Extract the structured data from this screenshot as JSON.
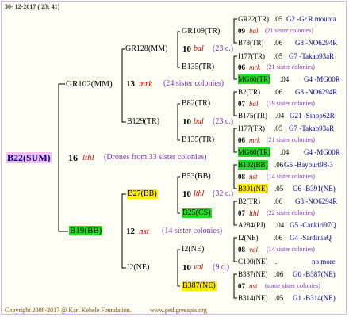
{
  "header": {
    "date": "30- 12-2017 ( 23: 41)"
  },
  "footer": {
    "copyright": "Copyright 2008-2017 @ Karl Kehele Foundation.",
    "url": "www.pedigreeapis.org"
  },
  "root": {
    "name": "B22(SUM)",
    "num": "16",
    "breed": "lthl",
    "note": "(Drones from 33 sister colonies)"
  },
  "sire": {
    "name": "GR102(MM)",
    "num": "13",
    "breed": "mrk",
    "note": "(24 sister colonies)"
  },
  "dam": {
    "name": "B19(BB)",
    "num": "12",
    "breed": "nst",
    "note": "(14 sister colonies)"
  },
  "ss": {
    "name": "GR128(MM)",
    "num": "10",
    "breed": "bal",
    "note": "(23 c.)"
  },
  "sd": {
    "name": "B129(TR)",
    "num": "10",
    "breed": "bal",
    "note": "(23 c.)"
  },
  "ds": {
    "name": "B27(BB)",
    "num": "10",
    "breed": "lthl",
    "note": "(32 c.)"
  },
  "dd": {
    "name": "I2(NE)",
    "num": "10",
    "breed": "val",
    "note": "(9 c.)"
  },
  "g": {
    "sss": "GR109(TR)",
    "ssd": "B135(TR)",
    "sds": "B82(TR)",
    "sdd": "B135(TR)",
    "dss": "B53(BB)",
    "dsd": "B25(CS)",
    "dds": "I2(NE)",
    "ddd": "B387(NE)"
  },
  "rows": [
    {
      "a": "GR22(TR)",
      "y": ".05",
      "c": "G2 -Gr.R.mounta"
    },
    {
      "n": "09",
      "b": "bal",
      "note": "(21 sister colonies)"
    },
    {
      "a": "B78(TR)",
      "y": ".06",
      "c": "G8 -NO6294R"
    },
    {
      "a": "I177(TR)",
      "y": ".05",
      "c": "G7 -Takab93aR"
    },
    {
      "n": "06",
      "b": "mrk",
      "note": "(21 sister colonies)"
    },
    {
      "a": "MG60(TR)",
      "y": ".04",
      "c": "G4 -MG00R"
    },
    {
      "a": "B2(TR)",
      "y": ".06",
      "c": "G8 -NO6294R"
    },
    {
      "n": "07",
      "b": "bal",
      "note": "(19 sister colonies)"
    },
    {
      "a": "B175(TR)",
      "y": ".04",
      "c": "G21 -Sinop62R"
    },
    {
      "a": "I177(TR)",
      "y": ".05",
      "c": "G7 -Takab93aR"
    },
    {
      "n": "06",
      "b": "mrk",
      "note": "(21 sister colonies)"
    },
    {
      "a": "MG60(TR)",
      "y": ".04",
      "c": "G4 -MG00R"
    },
    {
      "a": "B102(BB)",
      "y": ".06",
      "c": "G5 -Bayburt98-3"
    },
    {
      "n": "08",
      "b": "nst",
      "note": "(14 sister colonies)"
    },
    {
      "a": "B391(NE)",
      "y": ".05",
      "c": "G6 -B391(NE)"
    },
    {
      "a": "B2(TR)",
      "y": ".06",
      "c": "G8 -NO6294R"
    },
    {
      "n": "07",
      "b": "lthl",
      "note": "(22 sister colonies)"
    },
    {
      "a": "A284(PJ)",
      "y": ".04",
      "c": "G5 -Cankiri97Q"
    },
    {
      "a": "I2(NE)",
      "y": ".06",
      "c": "G4 -SardiniaQ"
    },
    {
      "n": "08",
      "b": "val",
      "note": "(14 sister colonies)"
    },
    {
      "a": "C100(NE)",
      "y": ".",
      "c": "no more"
    },
    {
      "a": "B387(NE)",
      "y": ".06",
      "c": "G0 -B387(NE)"
    },
    {
      "n": "07",
      "b": "nst",
      "note": "(some sister colonies)"
    },
    {
      "a": "B314(NE)",
      "y": ".05",
      "c": "G1 -B314(NE)"
    }
  ],
  "colors": {
    "green": "#22dd22",
    "yellow": "#ffee00",
    "pink": "#f3bff5",
    "red": "#cc0000",
    "purple": "#7a2fb5",
    "blue": "#00008b"
  }
}
